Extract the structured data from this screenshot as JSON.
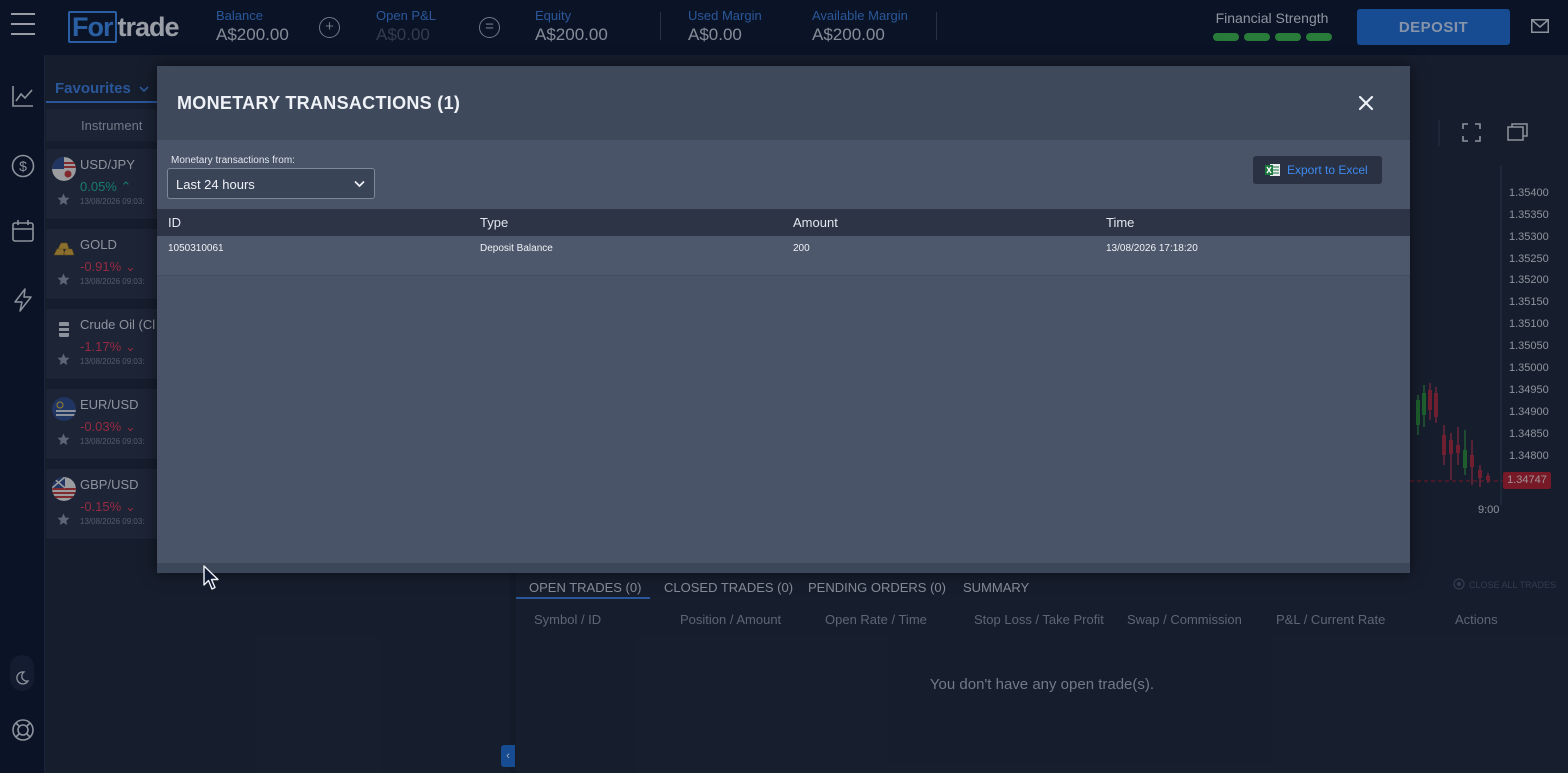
{
  "header": {
    "logo_prefix": "For",
    "logo_suffix": "trade",
    "stats": [
      {
        "label": "Balance",
        "value": "A$200.00"
      },
      {
        "label": "Open P&L",
        "value": "A$0.00"
      },
      {
        "label": "Equity",
        "value": "A$200.00"
      },
      {
        "label": "Used Margin",
        "value": "A$0.00"
      },
      {
        "label": "Available Margin",
        "value": "A$200.00"
      }
    ],
    "plus_symbol": "+",
    "equals_symbol": "=",
    "financial_strength_label": "Financial Strength",
    "financial_strength_level": 4,
    "deposit_label": "DEPOSIT",
    "colors": {
      "brand_blue": "#1f6ed4",
      "strength_green": "#3ab54a"
    }
  },
  "rail_icons": [
    "menu-icon",
    "chart-line-icon",
    "dollar-circle-icon",
    "calendar-icon",
    "lightning-icon",
    "moon-icon",
    "support-icon"
  ],
  "instruments": {
    "tab_label": "Favourites",
    "column_header": "Instrument",
    "items": [
      {
        "name": "USD/JPY",
        "change": "0.05%",
        "direction": "up",
        "date": "13/08/2026 09:03:"
      },
      {
        "name": "GOLD",
        "change": "-0.91%",
        "direction": "down",
        "date": "13/08/2026 09:03:"
      },
      {
        "name": "Crude Oil (Cl",
        "change": "-1.17%",
        "direction": "down",
        "date": "13/08/2026 09:03:"
      },
      {
        "name": "EUR/USD",
        "change": "-0.03%",
        "direction": "down",
        "date": "13/08/2026 09:03:"
      },
      {
        "name": "GBP/USD",
        "change": "-0.15%",
        "direction": "down",
        "date": "13/08/2026 09:03:"
      }
    ]
  },
  "chart": {
    "price_labels": [
      "1.35400",
      "1.35350",
      "1.35300",
      "1.35250",
      "1.35200",
      "1.35150",
      "1.35100",
      "1.35050",
      "1.35000",
      "1.34950",
      "1.34900",
      "1.34850",
      "1.34800"
    ],
    "current_price": "1.34747",
    "time_label": "9:00"
  },
  "modal": {
    "title": "MONETARY TRANSACTIONS (1)",
    "filter_label": "Monetary transactions from:",
    "filter_value": "Last 24 hours",
    "export_label": "Export to Excel",
    "columns": [
      "ID",
      "Type",
      "Amount",
      "Time"
    ],
    "rows": [
      {
        "id": "1050310061",
        "type": "Deposit Balance",
        "amount": "200",
        "time": "13/08/2026 17:18:20"
      }
    ]
  },
  "trades": {
    "tabs": [
      "OPEN TRADES (0)",
      "CLOSED TRADES (0)",
      "PENDING ORDERS (0)",
      "SUMMARY"
    ],
    "close_all_label": "CLOSE ALL TRADES",
    "columns": [
      "Symbol / ID",
      "Position / Amount",
      "Open Rate / Time",
      "Stop Loss / Take Profit",
      "Swap / Commission",
      "P&L / Current Rate",
      "Actions"
    ],
    "empty_message": "You don't have any open trade(s)."
  }
}
